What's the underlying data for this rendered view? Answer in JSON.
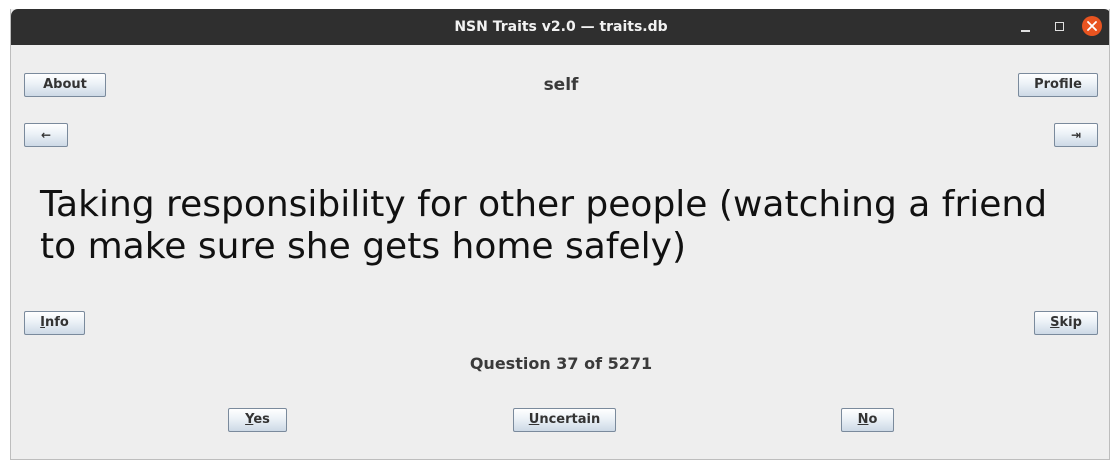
{
  "window": {
    "title": "NSN Traits v2.0 — traits.db"
  },
  "header": {
    "about_label": "About",
    "category": "self",
    "profile_label": "Profile",
    "back_label": "←",
    "forward_label": "⇥"
  },
  "question": {
    "text": "Taking responsibility for other people (watching a friend to make sure she gets home safely)"
  },
  "actions": {
    "info_prefix": "I",
    "info_rest": "nfo",
    "skip_prefix": "S",
    "skip_rest": "kip",
    "yes_prefix": "Y",
    "yes_rest": "es",
    "uncertain_prefix": "U",
    "uncertain_rest": "ncertain",
    "no_prefix": "N",
    "no_rest": "o"
  },
  "status": {
    "counter": "Question 37 of 5271"
  },
  "icons": {
    "close": "close-icon",
    "minimize": "minimize-icon",
    "maximize": "maximize-icon"
  },
  "colors": {
    "titlebar": "#2f2f2f",
    "close_button": "#e95420",
    "window_background": "#eeeeee"
  }
}
